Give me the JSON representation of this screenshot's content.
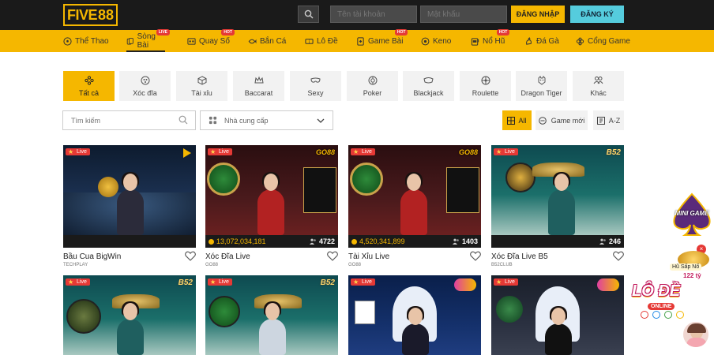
{
  "brand": {
    "logo_part1": "FIVE",
    "logo_part2": "88"
  },
  "header": {
    "username_placeholder": "Tên tài khoản",
    "password_placeholder": "Mật khẩu",
    "login_label": "ĐĂNG NHẬP",
    "register_label": "ĐĂNG KÝ"
  },
  "nav": [
    {
      "label": "Thể Thao",
      "badge": ""
    },
    {
      "label": "Sòng Bài",
      "badge": "LIVE"
    },
    {
      "label": "Quay Số",
      "badge": "HOT"
    },
    {
      "label": "Bắn Cá",
      "badge": ""
    },
    {
      "label": "Lô Đề",
      "badge": ""
    },
    {
      "label": "Game Bài",
      "badge": "HOT"
    },
    {
      "label": "Keno",
      "badge": ""
    },
    {
      "label": "Nổ Hũ",
      "badge": "HOT"
    },
    {
      "label": "Đá Gà",
      "badge": ""
    },
    {
      "label": "Cổng Game",
      "badge": ""
    }
  ],
  "categories": [
    {
      "label": "Tất cả",
      "icon": "grid-dots-icon"
    },
    {
      "label": "Xóc đĩa",
      "icon": "disc-icon"
    },
    {
      "label": "Tài xỉu",
      "icon": "dice-icon"
    },
    {
      "label": "Baccarat",
      "icon": "crown-icon"
    },
    {
      "label": "Sexy",
      "icon": "mask-icon"
    },
    {
      "label": "Poker",
      "icon": "chips-icon"
    },
    {
      "label": "Blackjack",
      "icon": "card-icon"
    },
    {
      "label": "Roulette",
      "icon": "roulette-icon"
    },
    {
      "label": "Dragon Tiger",
      "icon": "tiger-icon"
    },
    {
      "label": "Khác",
      "icon": "people-icon"
    }
  ],
  "filters": {
    "search_placeholder": "Tìm kiếm",
    "provider_label": "Nhà cung cấp",
    "all_label": "All",
    "new_label": "Game mới",
    "az_label": "A-Z"
  },
  "live_label": "Live",
  "games": [
    {
      "title": "Bầu Cua BigWin",
      "provider": "TECHPLAY",
      "jackpot": "",
      "players": ""
    },
    {
      "title": "Xóc Đĩa Live",
      "provider": "GO88",
      "jackpot": "13,072,034,181",
      "players": "4722"
    },
    {
      "title": "Tài Xỉu Live",
      "provider": "GO88",
      "jackpot": "4,520,341,899",
      "players": "1403"
    },
    {
      "title": "Xóc Đĩa Live B5",
      "provider": "B52CLUB",
      "jackpot": "",
      "players": "246"
    }
  ],
  "thumb_logos": {
    "go88": "GO88",
    "b52": "B52"
  },
  "side": {
    "mini_game": "MINI GAME",
    "no_hu_label": "Hũ Sấp Nổ",
    "no_hu_amount": "122 tỷ",
    "lode_label": "LÔ ĐỀ",
    "lode_sub": "ONLINE"
  },
  "colors": {
    "accent": "#f5b700",
    "dark": "#1a1a1a",
    "register": "#55ccdd",
    "live": "#e53935"
  }
}
